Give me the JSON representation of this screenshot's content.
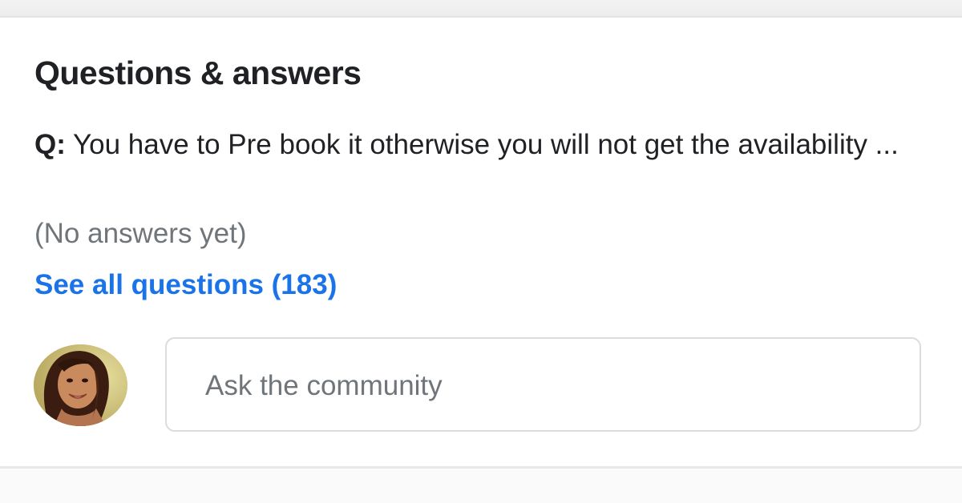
{
  "section": {
    "title": "Questions & answers"
  },
  "question": {
    "prefix": "Q:",
    "text": "You have to Pre book it otherwise you will not get the availability ..."
  },
  "answers": {
    "status": "(No answers yet)"
  },
  "see_all": {
    "label": "See all questions (183)"
  },
  "ask": {
    "placeholder": "Ask the community"
  },
  "colors": {
    "link": "#1a73e8",
    "text": "#202124",
    "muted": "#70757a",
    "border": "#dadce0"
  }
}
